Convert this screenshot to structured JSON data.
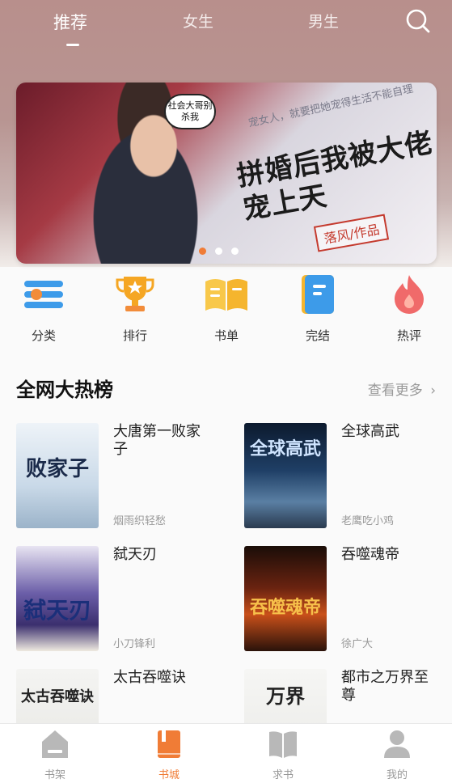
{
  "tabs": [
    {
      "label": "推荐"
    },
    {
      "label": "女生"
    },
    {
      "label": "男生"
    }
  ],
  "banner": {
    "speech": "社会大哥别杀我",
    "subtitle": "宠女人，就要把她宠得生活不能自理",
    "title": "拼婚后我被大佬宠上天",
    "author": "落风/作品",
    "slide_count": 3,
    "active_slide": 1
  },
  "categories": [
    {
      "label": "分类",
      "icon": "category-list-icon"
    },
    {
      "label": "排行",
      "icon": "trophy-icon"
    },
    {
      "label": "书单",
      "icon": "open-book-icon"
    },
    {
      "label": "完结",
      "icon": "finished-book-icon"
    },
    {
      "label": "热评",
      "icon": "flame-icon"
    }
  ],
  "section": {
    "title": "全网大热榜",
    "more": "查看更多"
  },
  "books": [
    {
      "title": "大唐第一败家子",
      "author": "烟雨织轻愁",
      "cover_text": "败家子"
    },
    {
      "title": "全球高武",
      "author": "老鹰吃小鸡",
      "cover_text": "全球高武"
    },
    {
      "title": "弑天刃",
      "author": "小刀锋利",
      "cover_text": "弑天刃"
    },
    {
      "title": "吞噬魂帝",
      "author": "徐广大",
      "cover_text": "吞噬魂帝"
    },
    {
      "title": "太古吞噬诀",
      "author": "",
      "cover_text": "太古吞噬诀"
    },
    {
      "title": "都市之万界至尊",
      "author": "",
      "cover_text": "万界"
    }
  ],
  "bottom_nav": [
    {
      "label": "书架"
    },
    {
      "label": "书城"
    },
    {
      "label": "求书"
    },
    {
      "label": "我的"
    }
  ],
  "colors": {
    "accent": "#f07c36"
  }
}
